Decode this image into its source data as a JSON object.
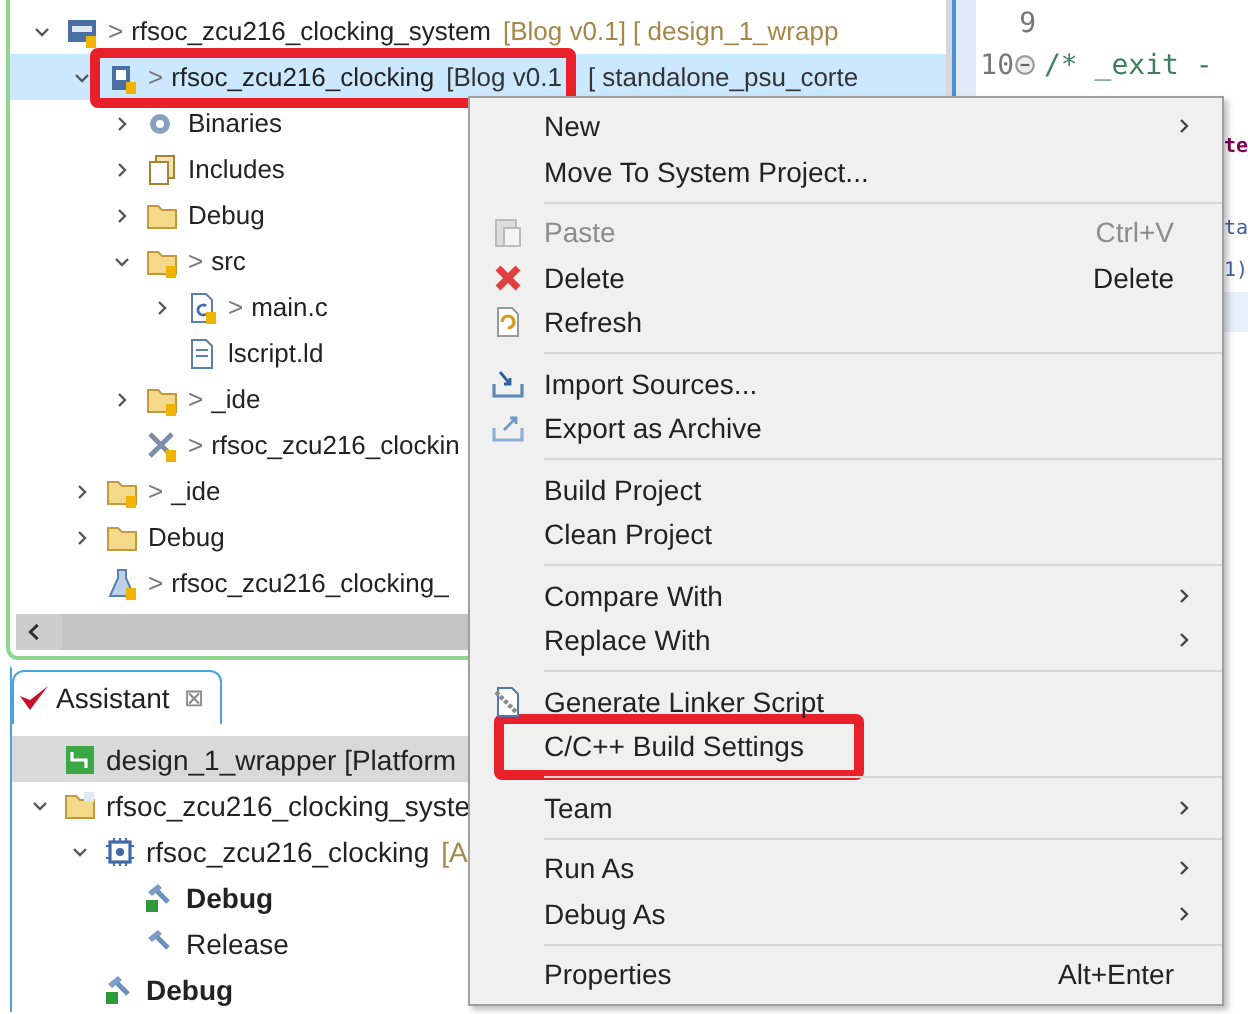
{
  "explorer": {
    "tree": [
      {
        "kind": "system",
        "expanded": true,
        "selected": false,
        "prefix": ">",
        "label": "rfsoc_zcu216_clocking_system",
        "suffix": "[Blog v0.1] [ design_1_wrapp",
        "children": [
          {
            "kind": "app",
            "expanded": true,
            "selected": true,
            "annotated": true,
            "prefix": ">",
            "label": "rfsoc_zcu216_clocking",
            "suffix": "[Blog v0.1",
            "tail": "[ standalone_psu_corte",
            "children": [
              {
                "kind": "binaries",
                "expanded": false,
                "selected": false,
                "label": "Binaries"
              },
              {
                "kind": "includes",
                "expanded": false,
                "selected": false,
                "label": "Includes"
              },
              {
                "kind": "folder",
                "expanded": false,
                "selected": false,
                "label": "Debug"
              },
              {
                "kind": "srcfolder",
                "expanded": true,
                "selected": false,
                "prefix": ">",
                "label": "src",
                "children": [
                  {
                    "kind": "cfile",
                    "expanded": false,
                    "selected": false,
                    "prefix": ">",
                    "label": "main.c"
                  },
                  {
                    "kind": "ldfile",
                    "selected": false,
                    "label": "lscript.ld"
                  }
                ]
              },
              {
                "kind": "editfolder",
                "expanded": false,
                "selected": false,
                "prefix": ">",
                "label": "_ide"
              },
              {
                "kind": "prjfile",
                "selected": false,
                "prefix": ">",
                "label": "rfsoc_zcu216_clockin"
              }
            ]
          },
          {
            "kind": "lockfolder",
            "expanded": false,
            "selected": false,
            "prefix": ">",
            "label": "_ide"
          },
          {
            "kind": "folder",
            "expanded": false,
            "selected": false,
            "label": "Debug"
          },
          {
            "kind": "launch",
            "selected": false,
            "prefix": ">",
            "label": "rfsoc_zcu216_clocking_"
          }
        ]
      }
    ]
  },
  "editor": {
    "lines": [
      {
        "kind": "plain",
        "number": "9"
      },
      {
        "kind": "comment",
        "number": "10",
        "fold": true,
        "text": "/* _exit -"
      },
      {
        "kind": "blank"
      },
      {
        "kind": "keyword",
        "text": "te"
      },
      {
        "kind": "blank"
      },
      {
        "kind": "plain",
        "text": "ta"
      },
      {
        "kind": "plain",
        "text": "1)"
      },
      {
        "kind": "current"
      }
    ]
  },
  "assistant": {
    "tab": {
      "label": "Assistant",
      "close": "⊠"
    },
    "tree": [
      {
        "kind": "platform",
        "selected": true,
        "label": "design_1_wrapper [Platform"
      },
      {
        "kind": "sysproject",
        "expanded": true,
        "selected": false,
        "label": "rfsoc_zcu216_clocking_syste",
        "children": [
          {
            "kind": "appproject",
            "expanded": true,
            "selected": false,
            "label": "rfsoc_zcu216_clocking",
            "suffix": "[A",
            "children": [
              {
                "kind": "config",
                "selected": false,
                "active": true,
                "label": "Debug"
              },
              {
                "kind": "config",
                "selected": false,
                "active": false,
                "label": "Release"
              }
            ]
          },
          {
            "kind": "config",
            "selected": false,
            "active": true,
            "label": "Debug"
          }
        ]
      }
    ]
  },
  "context_menu": {
    "items": [
      {
        "kind": "plain",
        "label": "New",
        "submenu": true
      },
      {
        "kind": "plain",
        "label": "Move To System Project..."
      },
      {
        "kind": "separator"
      },
      {
        "kind": "paste",
        "label": "Paste",
        "shortcut": "Ctrl+V",
        "disabled": true
      },
      {
        "kind": "delete",
        "label": "Delete",
        "shortcut": "Delete"
      },
      {
        "kind": "refresh",
        "label": "Refresh"
      },
      {
        "kind": "separator"
      },
      {
        "kind": "import",
        "label": "Import Sources..."
      },
      {
        "kind": "export",
        "label": "Export as Archive"
      },
      {
        "kind": "separator"
      },
      {
        "kind": "plain",
        "label": "Build Project"
      },
      {
        "kind": "plain",
        "label": "Clean Project"
      },
      {
        "kind": "separator"
      },
      {
        "kind": "plain",
        "label": "Compare With",
        "submenu": true
      },
      {
        "kind": "plain",
        "label": "Replace With",
        "submenu": true
      },
      {
        "kind": "separator"
      },
      {
        "kind": "linker",
        "label": "Generate Linker Script"
      },
      {
        "kind": "plain",
        "label": "C/C++ Build Settings",
        "annotated": true
      },
      {
        "kind": "separator"
      },
      {
        "kind": "plain",
        "label": "Team",
        "submenu": true
      },
      {
        "kind": "separator"
      },
      {
        "kind": "plain",
        "label": "Run As",
        "submenu": true
      },
      {
        "kind": "plain",
        "label": "Debug As",
        "submenu": true
      },
      {
        "kind": "separator"
      },
      {
        "kind": "plain",
        "label": "Properties",
        "shortcut": "Alt+Enter"
      }
    ]
  }
}
